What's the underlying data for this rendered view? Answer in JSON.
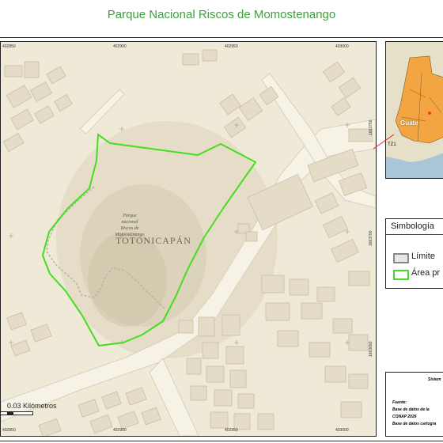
{
  "title": "Parque Nacional Riscos de Momostenango",
  "map": {
    "top_ticks": [
      "402850",
      "402900",
      "402950",
      "403000"
    ],
    "bottom_ticks": [
      "402850",
      "402900",
      "402950",
      "403000"
    ],
    "right_ticks": [
      "1663750",
      "1663700",
      "1663650"
    ],
    "park_label_lines": [
      "Parque",
      "nacional",
      "Riscos de",
      "Momostenango"
    ],
    "department_label": "TOTONICAPÁN",
    "boundary_color": "#44dd22",
    "background_color": "#efe9d7"
  },
  "scale": {
    "label": "0.03 Kilómetros"
  },
  "inset": {
    "country_label": "Guate",
    "code": "TZ1"
  },
  "legend": {
    "title": "Simbología",
    "items": [
      {
        "label": "Límite",
        "fill": "#e6e6e6",
        "stroke": "#888888"
      },
      {
        "label": "Área pr",
        "fill": "#ffffff",
        "stroke": "#44dd22"
      }
    ]
  },
  "info": {
    "heading": "Sistem",
    "fuente": "Fuente:",
    "lines": [
      "Base de datos de la",
      "CONAP 2026",
      "Base de datos cartogra"
    ]
  }
}
